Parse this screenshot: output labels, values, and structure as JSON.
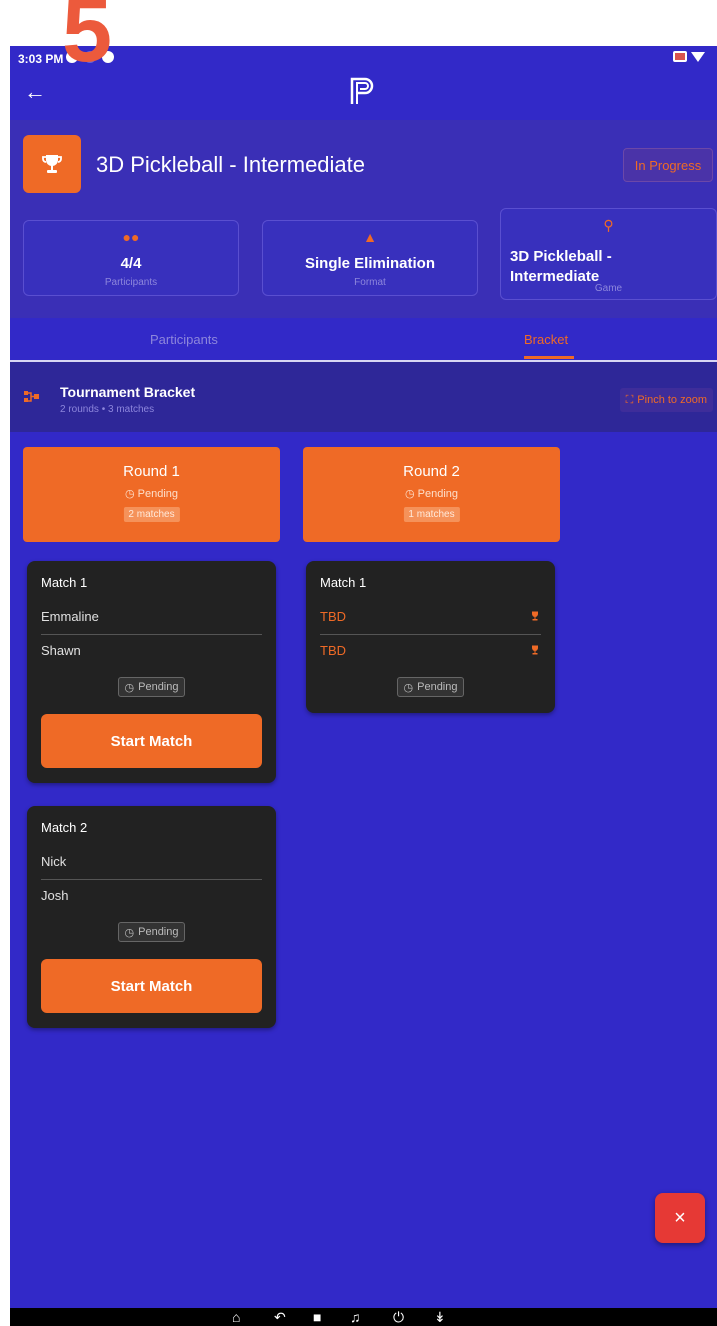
{
  "overlay": {
    "step": "5"
  },
  "status_bar": {
    "time": "3:03 PM"
  },
  "header": {
    "title": "3D Pickleball - Intermediate",
    "status": "In Progress",
    "stats": [
      {
        "value": "4/4",
        "label": "Participants",
        "icon": "people-icon"
      },
      {
        "value": "Single Elimination",
        "label": "Format",
        "icon": "shapes-icon"
      },
      {
        "value_line1": "3D Pickleball -",
        "value_line2": "Intermediate",
        "label": "Game",
        "icon": "pickleball-icon"
      }
    ]
  },
  "tabs": [
    {
      "label": "Participants",
      "active": false
    },
    {
      "label": "Bracket",
      "active": true
    }
  ],
  "bracket": {
    "title": "Tournament Bracket",
    "subtitle": "2 rounds • 3 matches",
    "zoom_hint": "Pinch to zoom"
  },
  "rounds": [
    {
      "title": "Round 1",
      "status": "Pending",
      "count": "2 matches",
      "matches": [
        {
          "title": "Match 1",
          "players": [
            "Emmaline",
            "Shawn"
          ],
          "status": "Pending",
          "action": "Start Match"
        },
        {
          "title": "Match 2",
          "players": [
            "Nick",
            "Josh"
          ],
          "status": "Pending",
          "action": "Start Match"
        }
      ]
    },
    {
      "title": "Round 2",
      "status": "Pending",
      "count": "1 matches",
      "matches": [
        {
          "title": "Match 1",
          "players": [
            "TBD",
            "TBD"
          ],
          "status": "Pending"
        }
      ]
    }
  ],
  "fab": {
    "label": "×"
  },
  "colors": {
    "background": "#3229c8",
    "accent": "#ef6a26",
    "card": "#222222",
    "fab": "#e63935"
  }
}
